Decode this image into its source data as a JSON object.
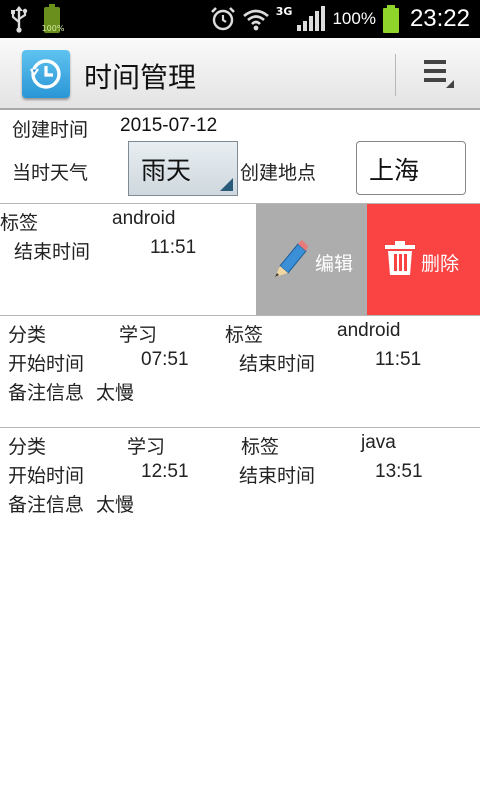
{
  "status_bar": {
    "battery_small_pct": "100%",
    "network": "3G",
    "battery_pct": "100%",
    "time": "23:22"
  },
  "action_bar": {
    "title": "时间管理",
    "app_icon": "clock-history-icon",
    "menu_icon": "overflow-menu-icon"
  },
  "header": {
    "created_time_label": "创建时间",
    "created_time_value": "2015-07-12",
    "weather_label": "当时天气",
    "weather_value": "雨天",
    "location_label": "创建地点",
    "location_value": "上海"
  },
  "swiped_item": {
    "tag_label": "标签",
    "tag_value": "android",
    "end_time_label": "结束时间",
    "end_time_value": "11:51",
    "edit_label": "编辑",
    "edit_icon": "pencil-icon",
    "delete_label": "删除",
    "delete_icon": "trash-icon"
  },
  "items": [
    {
      "category_label": "分类",
      "category_value": "学习",
      "tag_label": "标签",
      "tag_value": "android",
      "start_time_label": "开始时间",
      "start_time_value": "07:51",
      "end_time_label": "结束时间",
      "end_time_value": "11:51",
      "note_label": "备注信息",
      "note_value": "太慢"
    },
    {
      "category_label": "分类",
      "category_value": "学习",
      "tag_label": "标签",
      "tag_value": "java",
      "start_time_label": "开始时间",
      "start_time_value": "12:51",
      "end_time_label": "结束时间",
      "end_time_value": "13:51",
      "note_label": "备注信息",
      "note_value": "太慢"
    }
  ],
  "colors": {
    "edit_bg": "#adadad",
    "delete_bg": "#fa4343",
    "app_icon": "#3aa9e3"
  }
}
